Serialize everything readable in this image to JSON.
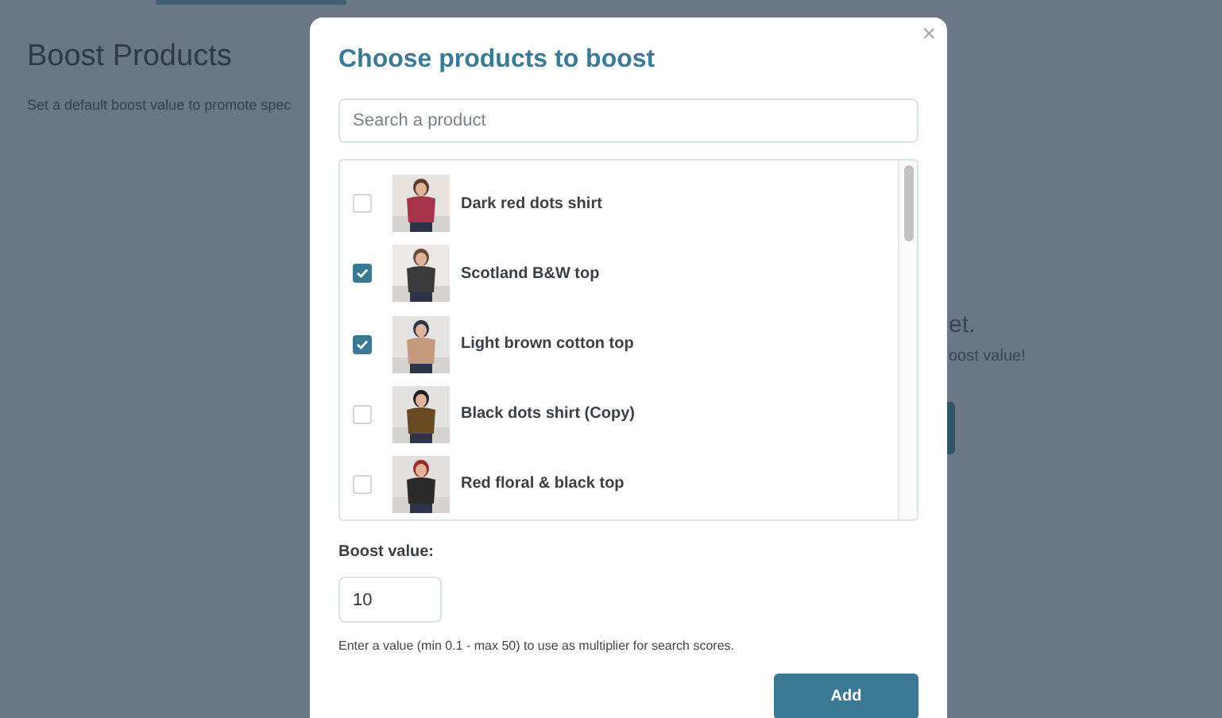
{
  "page": {
    "title": "Boost Products",
    "subtitle": "Set a default boost value to promote spec",
    "empty_title": "et.",
    "empty_text": "oost value!"
  },
  "dialog": {
    "title": "Choose products to boost",
    "close": "×",
    "search": {
      "placeholder": "Search a product"
    },
    "products": [
      {
        "name": "Dark red dots shirt",
        "checked": false
      },
      {
        "name": "Scotland B&W top",
        "checked": true
      },
      {
        "name": "Light brown cotton top",
        "checked": true
      },
      {
        "name": "Black dots shirt (Copy)",
        "checked": false
      },
      {
        "name": "Red floral & black top",
        "checked": false
      }
    ],
    "boost_label": "Boost value:",
    "boost_value": "10",
    "help": "Enter a value (min 0.1 - max 50) to use as multiplier for search scores.",
    "add_button": "Add"
  }
}
